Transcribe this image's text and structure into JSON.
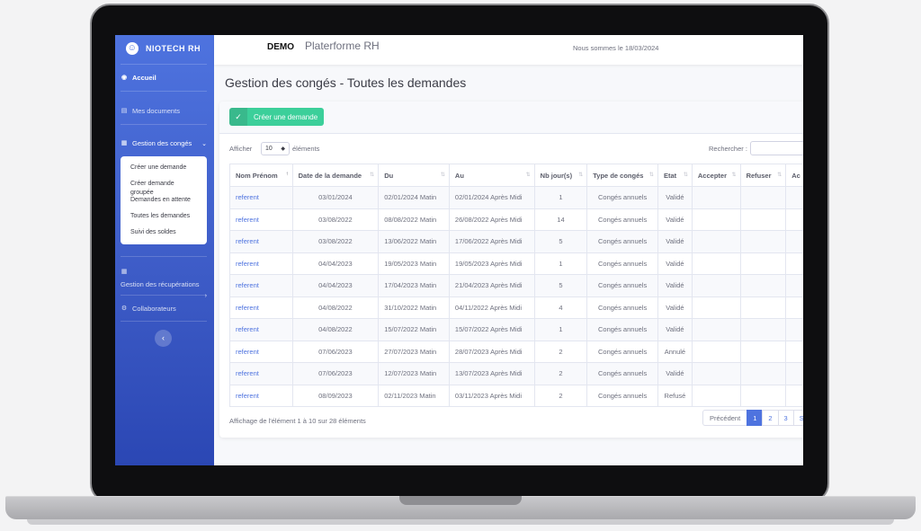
{
  "brand": {
    "name": "NIOTECH RH"
  },
  "sidebar": {
    "items": [
      {
        "label": "Accueil"
      },
      {
        "label": "Mes documents"
      },
      {
        "label": "Gestion des congés"
      },
      {
        "label": "Gestion des récupérations"
      },
      {
        "label": "Collaborateurs"
      }
    ],
    "submenu": [
      {
        "label": "Créer une demande"
      },
      {
        "label": "Créer demande groupée"
      },
      {
        "label": "Demandes en attente"
      },
      {
        "label": "Toutes les demandes"
      },
      {
        "label": "Suivi des soldes"
      }
    ],
    "toggle_glyph": "‹"
  },
  "topbar": {
    "demo": "DEMO",
    "platform": "Platerforme RH",
    "date": "Nous sommes le 18/03/2024"
  },
  "page": {
    "title": "Gestion des congés - Toutes les demandes",
    "create_button": "Créer une demande",
    "show_label": "Afficher",
    "show_value": "10",
    "show_suffix": "éléments",
    "search_label": "Rechercher :",
    "info": "Affichage de l'élément 1 à 10 sur 28 éléments"
  },
  "table": {
    "headers": [
      "Nom Prénom",
      "Date de la demande",
      "Du",
      "Au",
      "Nb jour(s)",
      "Type de congés",
      "Etat",
      "Accepter",
      "Refuser",
      "Ac"
    ],
    "rows": [
      [
        "referent",
        "03/01/2024",
        "02/01/2024 Matin",
        "02/01/2024 Après Midi",
        "1",
        "Congés annuels",
        "Validé"
      ],
      [
        "referent",
        "03/08/2022",
        "08/08/2022 Matin",
        "26/08/2022 Après Midi",
        "14",
        "Congés annuels",
        "Validé"
      ],
      [
        "referent",
        "03/08/2022",
        "13/06/2022 Matin",
        "17/06/2022 Après Midi",
        "5",
        "Congés annuels",
        "Validé"
      ],
      [
        "referent",
        "04/04/2023",
        "19/05/2023 Matin",
        "19/05/2023 Après Midi",
        "1",
        "Congés annuels",
        "Validé"
      ],
      [
        "referent",
        "04/04/2023",
        "17/04/2023 Matin",
        "21/04/2023 Après Midi",
        "5",
        "Congés annuels",
        "Validé"
      ],
      [
        "referent",
        "04/08/2022",
        "31/10/2022 Matin",
        "04/11/2022 Après Midi",
        "4",
        "Congés annuels",
        "Validé"
      ],
      [
        "referent",
        "04/08/2022",
        "15/07/2022 Matin",
        "15/07/2022 Après Midi",
        "1",
        "Congés annuels",
        "Validé"
      ],
      [
        "referent",
        "07/06/2023",
        "27/07/2023 Matin",
        "28/07/2023 Après Midi",
        "2",
        "Congés annuels",
        "Annulé"
      ],
      [
        "referent",
        "07/06/2023",
        "12/07/2023 Matin",
        "13/07/2023 Après Midi",
        "2",
        "Congés annuels",
        "Validé"
      ],
      [
        "referent",
        "08/09/2023",
        "02/11/2023 Matin",
        "03/11/2023 Après Midi",
        "2",
        "Congés annuels",
        "Refusé"
      ]
    ]
  },
  "pagination": {
    "prev": "Précédent",
    "pages": [
      "1",
      "2",
      "3",
      "S"
    ]
  }
}
